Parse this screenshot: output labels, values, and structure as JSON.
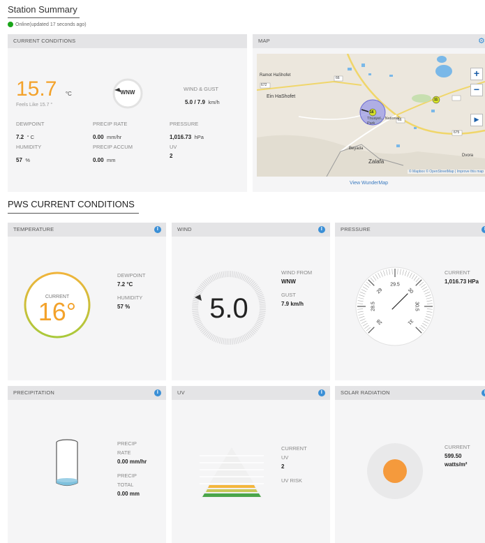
{
  "header": {
    "title": "Station Summary",
    "status": "Online(updated 17 seconds ago)",
    "status_color": "#1aa51a"
  },
  "current_conditions": {
    "header": "CURRENT CONDITIONS",
    "temperature": "15.7",
    "temp_unit": "°C",
    "feels_like": "Feels Like 15.7 °",
    "wind_dir": "WNW",
    "wind_gust_label": "WIND & GUST",
    "wind_gust_value": "5.0  / 7.9",
    "wind_gust_unit": "km/h",
    "dewpoint_label": "DEWPOINT",
    "dewpoint_value": "7.2",
    "dewpoint_unit": "° C",
    "precip_rate_label": "PRECIP RATE",
    "precip_rate_value": "0.00",
    "precip_rate_unit": "mm/hr",
    "pressure_label": "PRESSURE",
    "pressure_value": "1,016.73",
    "pressure_unit": "hPa",
    "humidity_label": "HUMIDITY",
    "humidity_value": "57",
    "humidity_unit": "%",
    "precip_accum_label": "PRECIP ACCUM",
    "precip_accum_value": "0.00",
    "precip_accum_unit": "mm",
    "uv_label": "UV",
    "uv_value": "2"
  },
  "map": {
    "header": "MAP",
    "zoom_in": "+",
    "zoom_out": "−",
    "play": "▶",
    "labels": {
      "ramot": "Ramot HaShofet",
      "ein": "Ein HaShofet",
      "park": "Thuayel... National Park",
      "bayada": "Beyada",
      "zalafa": "Zalafa",
      "dvora": "Dvora",
      "road_672": "672",
      "road_66": "66",
      "road_66b": "66",
      "road_675": "675",
      "pin": "16",
      "pin2": "11"
    },
    "attribution": "© Mapbox © OpenStreetMap | Improve this map",
    "link": "View WunderMap"
  },
  "pws": {
    "title": "PWS CURRENT CONDITIONS"
  },
  "temperature_tile": {
    "header": "TEMPERATURE",
    "current_label": "CURRENT",
    "value": "16°",
    "dewpoint_label": "DEWPOINT",
    "dewpoint_value": "7.2 °C",
    "humidity_label": "HUMIDITY",
    "humidity_value": "57 %"
  },
  "wind_tile": {
    "header": "WIND",
    "value": "5.0",
    "from_label": "WIND FROM",
    "from_value": "WNW",
    "gust_label": "GUST",
    "gust_value": "7.9 km/h"
  },
  "pressure_tile": {
    "header": "PRESSURE",
    "current_label": "CURRENT",
    "current_value": "1,016.73 HPa",
    "ticks": [
      "28",
      "28.5",
      "29",
      "29.5",
      "30",
      "30.5",
      "31"
    ],
    "gauge_value": 30.0,
    "gauge_min": 28,
    "gauge_max": 31
  },
  "precip_tile": {
    "header": "PRECIPITATION",
    "rate_label_1": "PRECIP",
    "rate_label_2": "RATE",
    "rate_value": "0.00 mm/hr",
    "total_label_1": "PRECIP",
    "total_label_2": "TOTAL",
    "total_value": "0.00 mm"
  },
  "uv_tile": {
    "header": "UV",
    "current_label_1": "CURRENT",
    "current_label_2": "UV",
    "current_value": "2",
    "risk_label": "UV RISK"
  },
  "solar_tile": {
    "header": "SOLAR RADIATION",
    "current_label": "CURRENT",
    "current_value": "599.50",
    "current_unit": "watts/m²"
  },
  "colors": {
    "accent_orange": "#f3a22b",
    "info_blue": "#3a8fd6",
    "sun_orange": "#f59a3c"
  }
}
